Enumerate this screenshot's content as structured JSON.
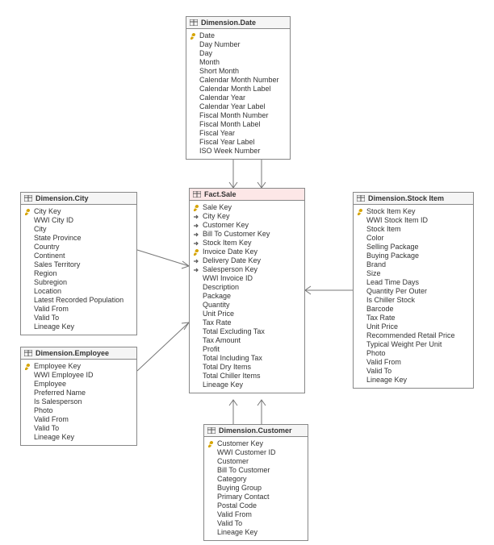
{
  "tables": {
    "date": {
      "title": "Dimension.Date",
      "columns": [
        {
          "name": "Date",
          "key": "pk"
        },
        {
          "name": "Day Number"
        },
        {
          "name": "Day"
        },
        {
          "name": "Month"
        },
        {
          "name": "Short Month"
        },
        {
          "name": "Calendar Month Number"
        },
        {
          "name": "Calendar Month Label"
        },
        {
          "name": "Calendar Year"
        },
        {
          "name": "Calendar Year Label"
        },
        {
          "name": "Fiscal Month Number"
        },
        {
          "name": "Fiscal Month Label"
        },
        {
          "name": "Fiscal Year"
        },
        {
          "name": "Fiscal Year Label"
        },
        {
          "name": "ISO Week Number"
        }
      ]
    },
    "city": {
      "title": "Dimension.City",
      "columns": [
        {
          "name": "City Key",
          "key": "pk"
        },
        {
          "name": "WWI City ID"
        },
        {
          "name": "City"
        },
        {
          "name": "State Province"
        },
        {
          "name": "Country"
        },
        {
          "name": "Continent"
        },
        {
          "name": "Sales Territory"
        },
        {
          "name": "Region"
        },
        {
          "name": "Subregion"
        },
        {
          "name": "Location"
        },
        {
          "name": "Latest Recorded Population"
        },
        {
          "name": "Valid From"
        },
        {
          "name": "Valid To"
        },
        {
          "name": "Lineage Key"
        }
      ]
    },
    "sale": {
      "title": "Fact.Sale",
      "columns": [
        {
          "name": "Sale Key",
          "key": "pk"
        },
        {
          "name": "City Key",
          "key": "fk"
        },
        {
          "name": "Customer Key",
          "key": "fk"
        },
        {
          "name": "Bill To Customer Key",
          "key": "fk"
        },
        {
          "name": "Stock Item Key",
          "key": "fk"
        },
        {
          "name": "Invoice Date Key",
          "key": "pk"
        },
        {
          "name": "Delivery Date Key",
          "key": "fk"
        },
        {
          "name": "Salesperson Key",
          "key": "fk"
        },
        {
          "name": "WWI Invoice ID"
        },
        {
          "name": "Description"
        },
        {
          "name": "Package"
        },
        {
          "name": "Quantity"
        },
        {
          "name": "Unit Price"
        },
        {
          "name": "Tax Rate"
        },
        {
          "name": "Total Excluding Tax"
        },
        {
          "name": "Tax Amount"
        },
        {
          "name": "Profit"
        },
        {
          "name": "Total Including Tax"
        },
        {
          "name": "Total Dry Items"
        },
        {
          "name": "Total Chiller Items"
        },
        {
          "name": "Lineage Key"
        }
      ]
    },
    "employee": {
      "title": "Dimension.Employee",
      "columns": [
        {
          "name": "Employee Key",
          "key": "pk"
        },
        {
          "name": "WWI Employee ID"
        },
        {
          "name": "Employee"
        },
        {
          "name": "Preferred Name"
        },
        {
          "name": "Is Salesperson"
        },
        {
          "name": "Photo"
        },
        {
          "name": "Valid From"
        },
        {
          "name": "Valid To"
        },
        {
          "name": "Lineage Key"
        }
      ]
    },
    "stockitem": {
      "title": "Dimension.Stock Item",
      "columns": [
        {
          "name": "Stock Item Key",
          "key": "pk"
        },
        {
          "name": "WWI Stock Item ID"
        },
        {
          "name": "Stock Item"
        },
        {
          "name": "Color"
        },
        {
          "name": "Selling Package"
        },
        {
          "name": "Buying Package"
        },
        {
          "name": "Brand"
        },
        {
          "name": "Size"
        },
        {
          "name": "Lead Time Days"
        },
        {
          "name": "Quantity Per Outer"
        },
        {
          "name": "Is Chiller Stock"
        },
        {
          "name": "Barcode"
        },
        {
          "name": "Tax Rate"
        },
        {
          "name": "Unit Price"
        },
        {
          "name": "Recommended Retail Price"
        },
        {
          "name": "Typical Weight Per Unit"
        },
        {
          "name": "Photo"
        },
        {
          "name": "Valid From"
        },
        {
          "name": "Valid To"
        },
        {
          "name": "Lineage Key"
        }
      ]
    },
    "customer": {
      "title": "Dimension.Customer",
      "columns": [
        {
          "name": "Customer Key",
          "key": "pk"
        },
        {
          "name": "WWI Customer ID"
        },
        {
          "name": "Customer"
        },
        {
          "name": "Bill To Customer"
        },
        {
          "name": "Category"
        },
        {
          "name": "Buying Group"
        },
        {
          "name": "Primary Contact"
        },
        {
          "name": "Postal Code"
        },
        {
          "name": "Valid From"
        },
        {
          "name": "Valid To"
        },
        {
          "name": "Lineage Key"
        }
      ]
    }
  }
}
